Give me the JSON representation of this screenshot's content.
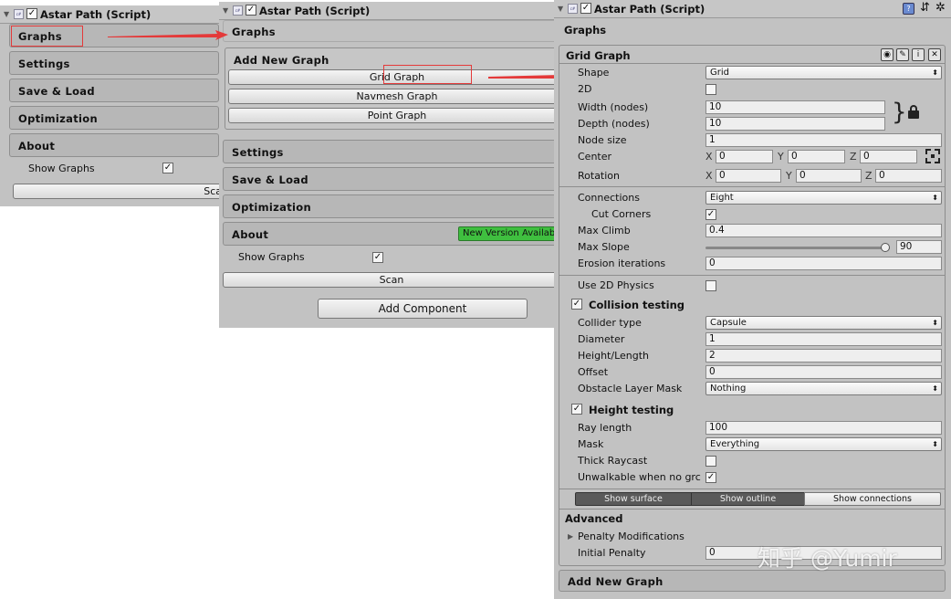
{
  "p1": {
    "title": "Astar Path (Script)",
    "graphs": "Graphs",
    "settings": "Settings",
    "save_load": "Save & Load",
    "optimization": "Optimization",
    "about": "About",
    "show_graphs": "Show Graphs",
    "scan_partial": "Sca",
    "icon": "script-icon"
  },
  "p2": {
    "title": "Astar Path (Script)",
    "graphs": "Graphs",
    "add_new_graph": "Add New Graph",
    "grid_graph": "Grid Graph",
    "navmesh_graph": "Navmesh Graph",
    "point_graph": "Point Graph",
    "settings": "Settings",
    "save_load": "Save & Load",
    "optimization": "Optimization",
    "about": "About",
    "new_version": "New Version Availab",
    "show_graphs": "Show Graphs",
    "scan": "Scan",
    "add_component": "Add Component"
  },
  "p3": {
    "title": "Astar Path (Script)",
    "graphs": "Graphs",
    "grid_graph": "Grid Graph",
    "shape_label": "Shape",
    "shape_value": "Grid",
    "two_d_label": "2D",
    "width_label": "Width (nodes)",
    "width_value": "10",
    "depth_label": "Depth (nodes)",
    "depth_value": "10",
    "node_size_label": "Node size",
    "node_size_value": "1",
    "center_label": "Center",
    "center_x": "0",
    "center_y": "0",
    "center_z": "0",
    "rotation_label": "Rotation",
    "rot_x": "0",
    "rot_y": "0",
    "rot_z": "0",
    "axis_x": "X",
    "axis_y": "Y",
    "axis_z": "Z",
    "connections_label": "Connections",
    "connections_value": "Eight",
    "cut_corners_label": "Cut Corners",
    "max_climb_label": "Max Climb",
    "max_climb_value": "0.4",
    "max_slope_label": "Max Slope",
    "max_slope_value": "90",
    "max_slope_fraction": 1.0,
    "erosion_label": "Erosion iterations",
    "erosion_value": "0",
    "use2d_label": "Use 2D Physics",
    "collision_header": "Collision testing",
    "collider_type_label": "Collider type",
    "collider_type_value": "Capsule",
    "diameter_label": "Diameter",
    "diameter_value": "1",
    "height_length_label": "Height/Length",
    "height_length_value": "2",
    "offset_label": "Offset",
    "offset_value": "0",
    "obstacle_label": "Obstacle Layer Mask",
    "obstacle_value": "Nothing",
    "height_header": "Height testing",
    "ray_length_label": "Ray length",
    "ray_length_value": "100",
    "mask_label": "Mask",
    "mask_value": "Everything",
    "thick_raycast_label": "Thick Raycast",
    "unwalkable_label": "Unwalkable when no grc",
    "show_surface": "Show surface",
    "show_outline": "Show outline",
    "show_connections": "Show connections",
    "advanced": "Advanced",
    "penalty_mod": "Penalty Modifications",
    "initial_penalty_label": "Initial Penalty",
    "initial_penalty_value": "0",
    "add_new_graph": "Add New Graph"
  },
  "watermark": "知乎 @Yumir",
  "colors": {
    "panel": "#c2c2c2",
    "highlight": "#e43a3a",
    "new_version": "#3fbf3f"
  }
}
